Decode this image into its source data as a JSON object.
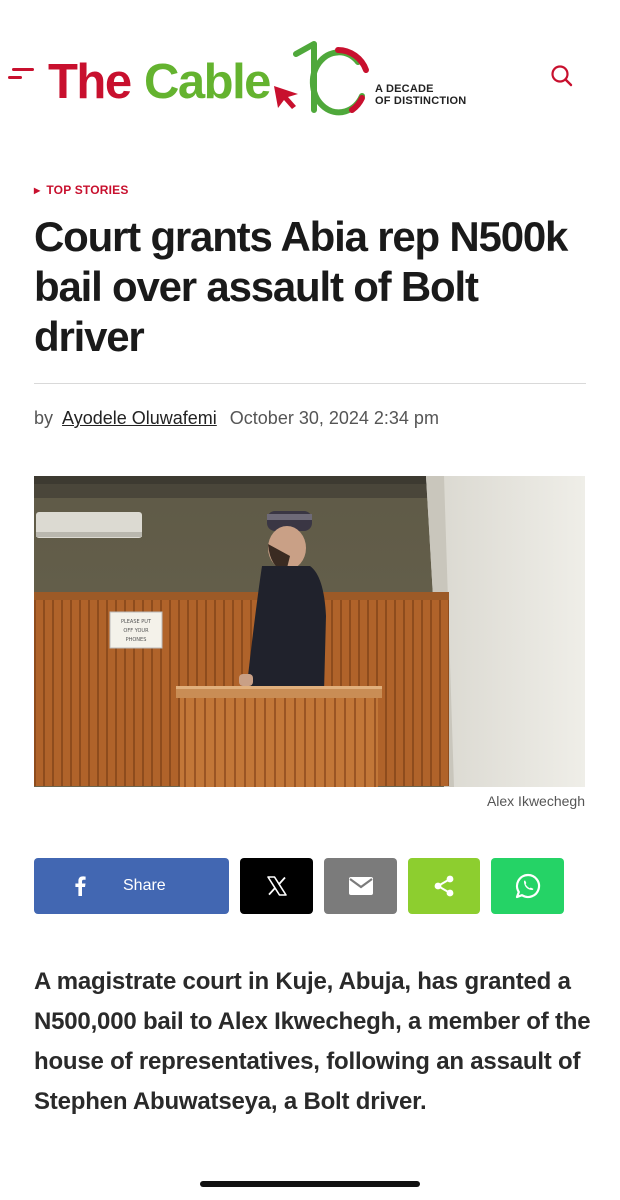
{
  "header": {
    "logo_the": "The",
    "logo_cable": "Cable",
    "logo_tagline_line1": "A DECADE",
    "logo_tagline_line2": "OF DISTINCTION",
    "menu_icon": "hamburger-icon",
    "search_icon": "search-icon"
  },
  "article": {
    "category": "TOP STORIES",
    "title": "Court grants Abia rep N500k bail over assault of Bolt driver",
    "byline_prefix": "by",
    "author": "Ayodele Oluwafemi",
    "date": "October 30, 2024 2:34 pm",
    "photo_caption": "Alex Ikwechegh",
    "sign_line1": "PLEASE PUT",
    "sign_line2": "OFF YOUR",
    "sign_line3": "PHONES",
    "lead": "A magistrate court in Kuje, Abuja, has granted a N500,000 bail to Alex Ikwechegh, a member of the house of representatives, following an assault of Stephen Abuwatseya, a Bolt driver."
  },
  "share": {
    "facebook_label": "Share",
    "buttons": [
      "facebook",
      "x",
      "email",
      "share",
      "whatsapp"
    ]
  },
  "colors": {
    "brand_red": "#c8102e",
    "brand_green": "#64b32f",
    "facebook": "#4267b2",
    "x": "#000000",
    "email": "#7b7b7b",
    "share": "#8dce2f",
    "whatsapp": "#25d366"
  }
}
